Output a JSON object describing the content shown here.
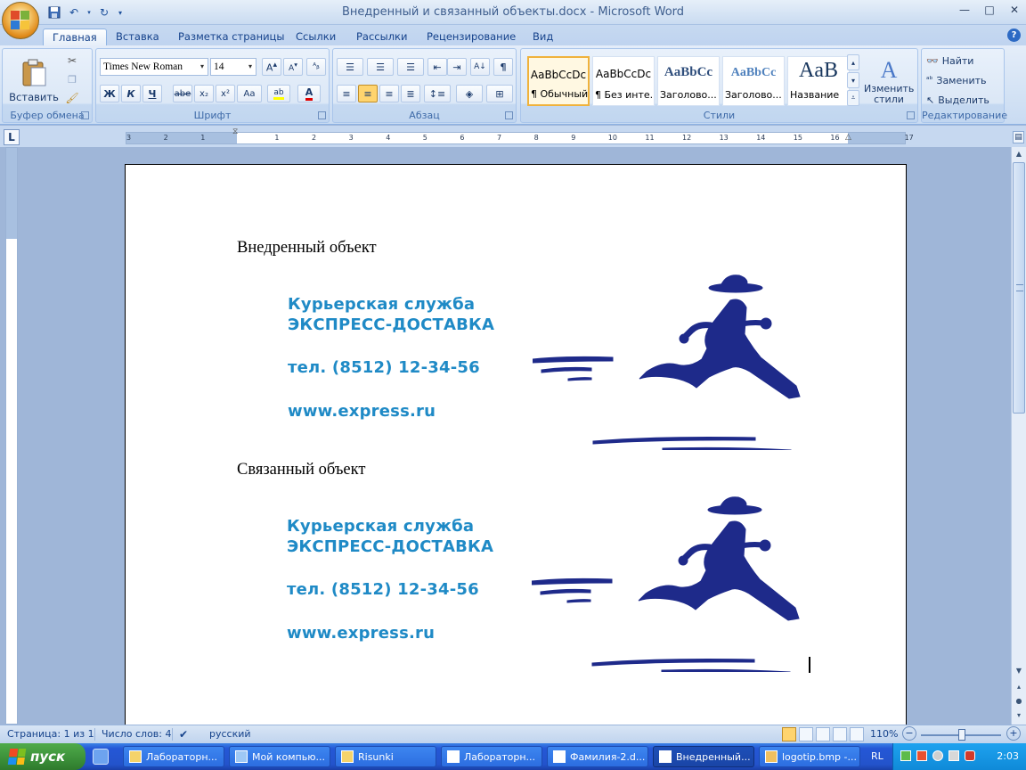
{
  "window": {
    "title": "Внедренный и связанный объекты.docx - Microsoft Word",
    "controls": [
      "—",
      "□",
      "✕"
    ]
  },
  "quick_access": [
    "save-icon",
    "undo-icon",
    "redo-icon",
    "customize-icon"
  ],
  "tabs": [
    {
      "label": "Главная",
      "active": true
    },
    {
      "label": "Вставка"
    },
    {
      "label": "Разметка страницы"
    },
    {
      "label": "Ссылки"
    },
    {
      "label": "Рассылки"
    },
    {
      "label": "Рецензирование"
    },
    {
      "label": "Вид"
    }
  ],
  "ribbon": {
    "clipboard": {
      "label": "Буфер обмена",
      "paste": "Вставить"
    },
    "font": {
      "label": "Шрифт",
      "family": "Times New Roman",
      "size": "14",
      "bold": "Ж",
      "italic": "К",
      "underline": "Ч",
      "strike": "abe",
      "sub": "x₂",
      "sup": "x²",
      "case": "Aa"
    },
    "paragraph": {
      "label": "Абзац",
      "pilcrow": "¶"
    },
    "styles": {
      "label": "Стили",
      "items": [
        {
          "sample": "AaBbCcDc",
          "name": "¶ Обычный",
          "selected": true
        },
        {
          "sample": "AaBbCcDc",
          "name": "¶ Без инте..."
        },
        {
          "sample": "AaBbCc",
          "name": "Заголово..."
        },
        {
          "sample": "AaBbCc",
          "name": "Заголово..."
        },
        {
          "sample": "AaB",
          "name": "Название"
        }
      ],
      "change": "Изменить стили"
    },
    "editing": {
      "label": "Редактирование",
      "find": "Найти",
      "replace": "Заменить",
      "select": "Выделить"
    }
  },
  "ruler": {
    "numbers": [
      "3",
      "2",
      "1",
      "",
      "1",
      "2",
      "3",
      "4",
      "5",
      "6",
      "7",
      "8",
      "9",
      "10",
      "11",
      "12",
      "13",
      "14",
      "15",
      "16",
      "",
      "17"
    ]
  },
  "document": {
    "heading1": "Внедренный объект",
    "heading2": "Связанный объект",
    "logo": {
      "line1": "Курьерская служба",
      "line2": "ЭКСПРЕСС-ДОСТАВКА",
      "phone": "тел. (8512) 12-34-56",
      "web": "www.express.ru",
      "text_color": "#1f8ac6",
      "figure_color": "#1e2a8a"
    }
  },
  "statusbar": {
    "page": "Страница: 1 из 1",
    "words": "Число слов: 4",
    "language": "русский",
    "zoom": "110%"
  },
  "taskbar": {
    "start": "пуск",
    "tasks": [
      {
        "label": "Лабораторн..."
      },
      {
        "label": "Мой компью..."
      },
      {
        "label": "Risunki"
      },
      {
        "label": "Лабораторн..."
      },
      {
        "label": "Фамилия-2.d..."
      },
      {
        "label": "Внедренный...",
        "active": true
      },
      {
        "label": "logotip.bmp -..."
      }
    ],
    "lang": "RL",
    "clock": "2:03"
  }
}
